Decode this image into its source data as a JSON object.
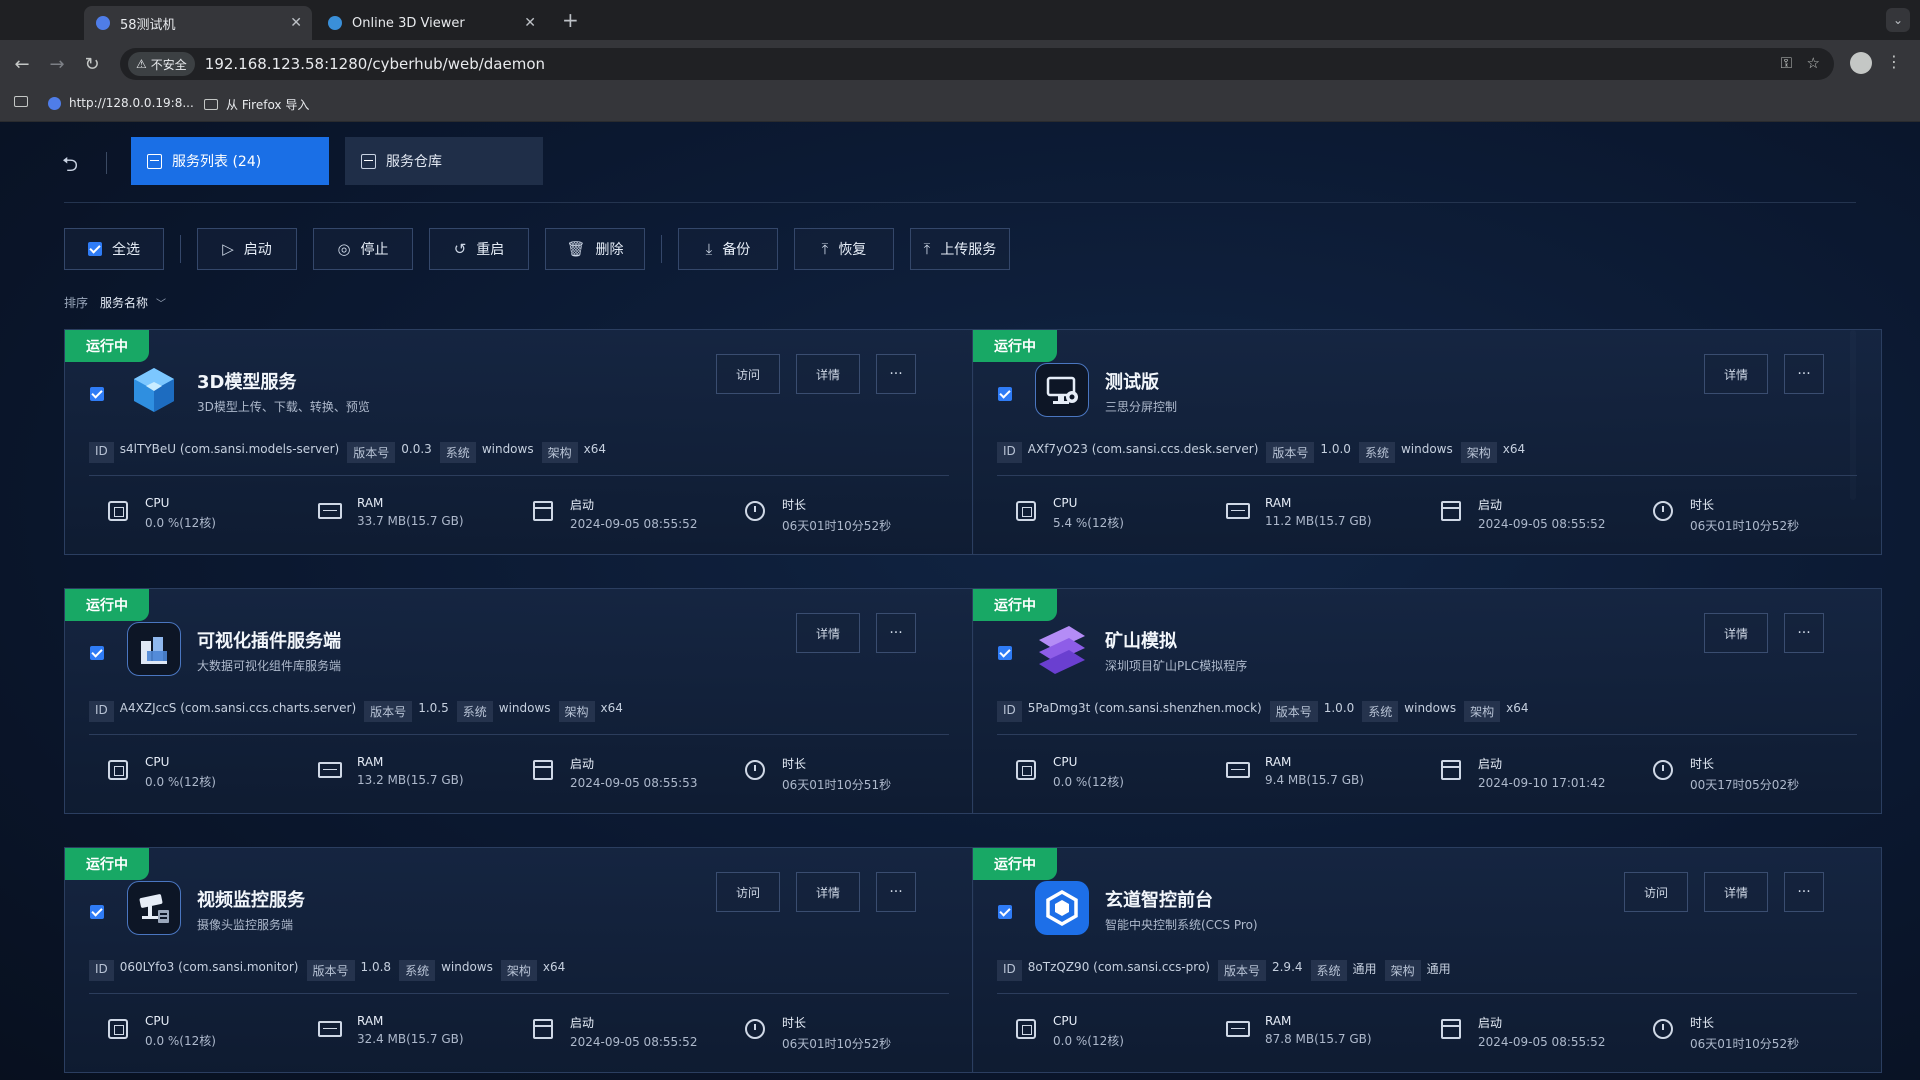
{
  "browser": {
    "tabs": [
      {
        "title": "58测试机",
        "active": true
      },
      {
        "title": "Online 3D Viewer",
        "active": false
      }
    ],
    "security_label": "不安全",
    "url": "192.168.123.58:1280/cyberhub/web/daemon",
    "bookmarks": [
      {
        "label": "http://128.0.0.19:8..."
      },
      {
        "label": "从 Firefox 导入"
      }
    ]
  },
  "app": {
    "tabs": [
      {
        "label": "服务列表 (24)",
        "active": true
      },
      {
        "label": "服务仓库",
        "active": false
      }
    ],
    "actions": {
      "select_all": "全选",
      "start": "启动",
      "stop": "停止",
      "restart": "重启",
      "delete": "删除",
      "backup": "备份",
      "restore": "恢复",
      "upload": "上传服务"
    },
    "sort": {
      "label": "排序",
      "value": "服务名称"
    },
    "labels": {
      "id": "ID",
      "version": "版本号",
      "os": "系统",
      "arch": "架构",
      "cpu": "CPU",
      "ram": "RAM",
      "start": "启动",
      "duration": "时长",
      "visit": "访问",
      "detail": "详情",
      "more": "···"
    },
    "services": [
      {
        "status": "运行中",
        "name": "3D模型服务",
        "desc": "3D模型上传、下载、转换、预览",
        "id": "s4lTYBeU (com.sansi.models-server)",
        "version": "0.0.3",
        "os": "windows",
        "arch": "x64",
        "cpu": "0.0 %(12核)",
        "ram": "33.7 MB(15.7 GB)",
        "start": "2024-09-05 08:55:52",
        "duration": "06天01时10分52秒",
        "has_visit": true,
        "icon": "cube-icon"
      },
      {
        "status": "运行中",
        "name": "测试版",
        "desc": "三思分屏控制",
        "id": "AXf7yO23 (com.sansi.ccs.desk.server)",
        "version": "1.0.0",
        "os": "windows",
        "arch": "x64",
        "cpu": "5.4 %(12核)",
        "ram": "11.2 MB(15.7 GB)",
        "start": "2024-09-05 08:55:52",
        "duration": "06天01时10分52秒",
        "has_visit": false,
        "icon": "monitor-icon"
      },
      {
        "status": "运行中",
        "name": "可视化插件服务端",
        "desc": "大数据可视化组件库服务端",
        "id": "A4XZJccS (com.sansi.ccs.charts.server)",
        "version": "1.0.5",
        "os": "windows",
        "arch": "x64",
        "cpu": "0.0 %(12核)",
        "ram": "13.2 MB(15.7 GB)",
        "start": "2024-09-05 08:55:53",
        "duration": "06天01时10分51秒",
        "has_visit": false,
        "icon": "blocks-icon"
      },
      {
        "status": "运行中",
        "name": "矿山模拟",
        "desc": "深圳项目矿山PLC模拟程序",
        "id": "5PaDmg3t (com.sansi.shenzhen.mock)",
        "version": "1.0.0",
        "os": "windows",
        "arch": "x64",
        "cpu": "0.0 %(12核)",
        "ram": "9.4 MB(15.7 GB)",
        "start": "2024-09-10 17:01:42",
        "duration": "00天17时05分02秒",
        "has_visit": false,
        "icon": "layers-icon"
      },
      {
        "status": "运行中",
        "name": "视频监控服务",
        "desc": "摄像头监控服务端",
        "id": "060LYfo3 (com.sansi.monitor)",
        "version": "1.0.8",
        "os": "windows",
        "arch": "x64",
        "cpu": "0.0 %(12核)",
        "ram": "32.4 MB(15.7 GB)",
        "start": "2024-09-05 08:55:52",
        "duration": "06天01时10分52秒",
        "has_visit": true,
        "icon": "camera-icon"
      },
      {
        "status": "运行中",
        "name": "玄道智控前台",
        "desc": "智能中央控制系统(CCS Pro)",
        "id": "8oTzQZ90 (com.sansi.ccs-pro)",
        "version": "2.9.4",
        "os": "通用",
        "arch": "通用",
        "cpu": "0.0 %(12核)",
        "ram": "87.8 MB(15.7 GB)",
        "start": "2024-09-05 08:55:52",
        "duration": "06天01时10分52秒",
        "has_visit": true,
        "icon": "hexagon-icon"
      }
    ]
  },
  "colors": {
    "accent": "#1a6fe6",
    "running": "#18a865",
    "checkbox": "#2f7cf6"
  }
}
